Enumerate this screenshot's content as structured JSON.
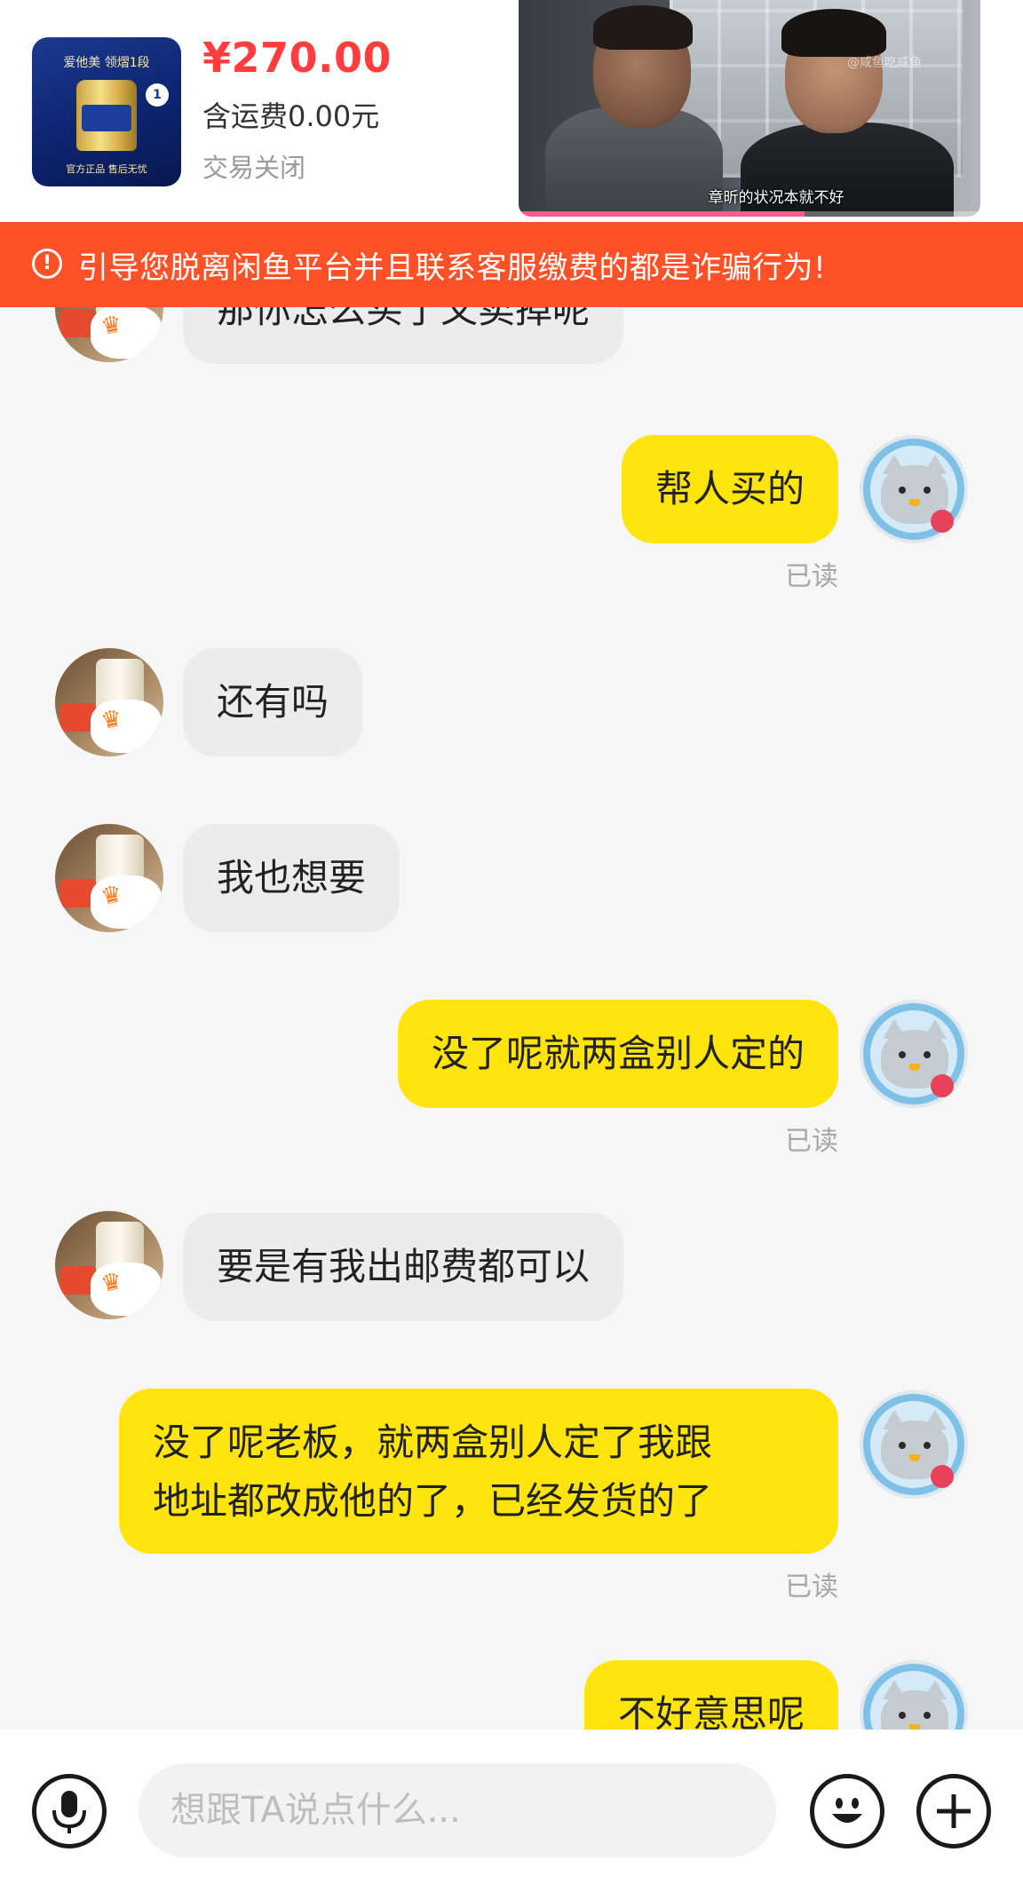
{
  "product": {
    "price": "¥270.00",
    "shipping": "含运费0.00元",
    "status": "交易关闭",
    "image_text_top": "爱他美 领熠1段",
    "image_badge": "1",
    "image_text_bottom": "官方正品 售后无忧"
  },
  "video": {
    "subtitle": "章昕的状况本就不好",
    "watermark": "@咸鱼吃咸鱼",
    "progress": 0.62,
    "accent_color": "#ff5b8a"
  },
  "warning": {
    "icon": "exclamation-circle-icon",
    "text": "引导您脱离闲鱼平台并且联系客服缴费的都是诈骗行为!",
    "color": "#ff5128"
  },
  "messages": [
    {
      "side": "left",
      "text": "那你怎么买了又卖掉呢"
    },
    {
      "side": "right",
      "text": "帮人买的",
      "status": "已读"
    },
    {
      "side": "left",
      "text": "还有吗"
    },
    {
      "side": "left",
      "text": "我也想要"
    },
    {
      "side": "right",
      "text": "没了呢就两盒别人定的",
      "status": "已读"
    },
    {
      "side": "left",
      "text": "要是有我出邮费都可以"
    },
    {
      "side": "right",
      "lines": [
        "没了呢老板，就两盒别人定了我跟",
        "地址都改成他的了，已经发货的了"
      ],
      "status": "已读"
    },
    {
      "side": "right",
      "text": "不好意思呢"
    }
  ],
  "input": {
    "placeholder": "想跟TA说点什么..."
  },
  "colors": {
    "self_bubble": "#ffe40d",
    "other_bubble": "#ececec",
    "price": "#ff3d3d"
  },
  "icons": {
    "voice": "microphone-icon",
    "emoji": "smiley-icon",
    "more": "plus-icon"
  }
}
